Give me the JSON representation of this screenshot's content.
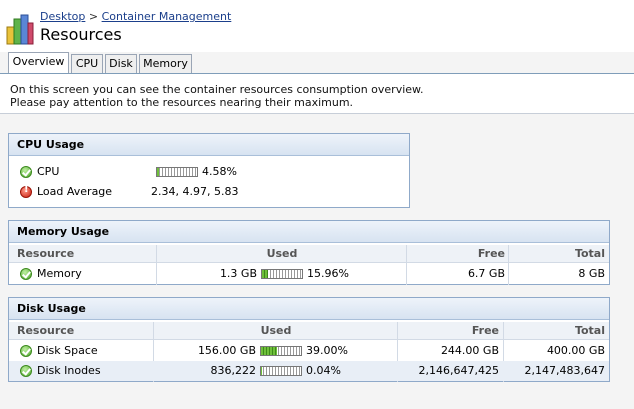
{
  "header": {
    "breadcrumb": [
      {
        "label": "Desktop"
      },
      {
        "label": "Container Management"
      }
    ],
    "breadcrumb_sep": ">",
    "title": "Resources",
    "icon": "resources-bar-chart-icon"
  },
  "tabs": [
    {
      "label": "Overview",
      "active": true
    },
    {
      "label": "CPU",
      "active": false
    },
    {
      "label": "Disk",
      "active": false
    },
    {
      "label": "Memory",
      "active": false
    }
  ],
  "info": {
    "line1": "On this screen you can see the container resources consumption overview.",
    "line2": "Please pay attention to the resources nearing their maximum."
  },
  "cpu_panel": {
    "title": "CPU Usage",
    "rows": [
      {
        "label": "CPU",
        "status": "ok",
        "value": "4.58%",
        "bar_fraction": 0.0458
      },
      {
        "label": "Load Average",
        "status": "error",
        "value": "2.34, 4.97, 5.83"
      }
    ]
  },
  "memory_panel": {
    "title": "Memory Usage",
    "columns": [
      "Resource",
      "Used",
      "Free",
      "Total"
    ],
    "rows": [
      {
        "label": "Memory",
        "status": "ok",
        "used": "1.3 GB",
        "used_percent": "15.96%",
        "bar_fraction": 0.1596,
        "free": "6.7 GB",
        "total": "8 GB"
      }
    ]
  },
  "disk_panel": {
    "title": "Disk Usage",
    "columns": [
      "Resource",
      "Used",
      "Free",
      "Total"
    ],
    "rows": [
      {
        "label": "Disk Space",
        "status": "ok",
        "used": "156.00 GB",
        "used_percent": "39.00%",
        "bar_fraction": 0.39,
        "free": "244.00 GB",
        "total": "400.00 GB"
      },
      {
        "label": "Disk Inodes",
        "status": "ok",
        "used": "836,222",
        "used_percent": "0.04%",
        "bar_fraction": 0.0004,
        "free": "2,146,647,425",
        "total": "2,147,483,647"
      }
    ]
  },
  "colors": {
    "panel_border": "#8fa9c9",
    "link": "#1b3f8b",
    "ok_status": "#4fa52a",
    "error_status": "#c81b0c",
    "bar_fill": "#6fbf3a"
  }
}
